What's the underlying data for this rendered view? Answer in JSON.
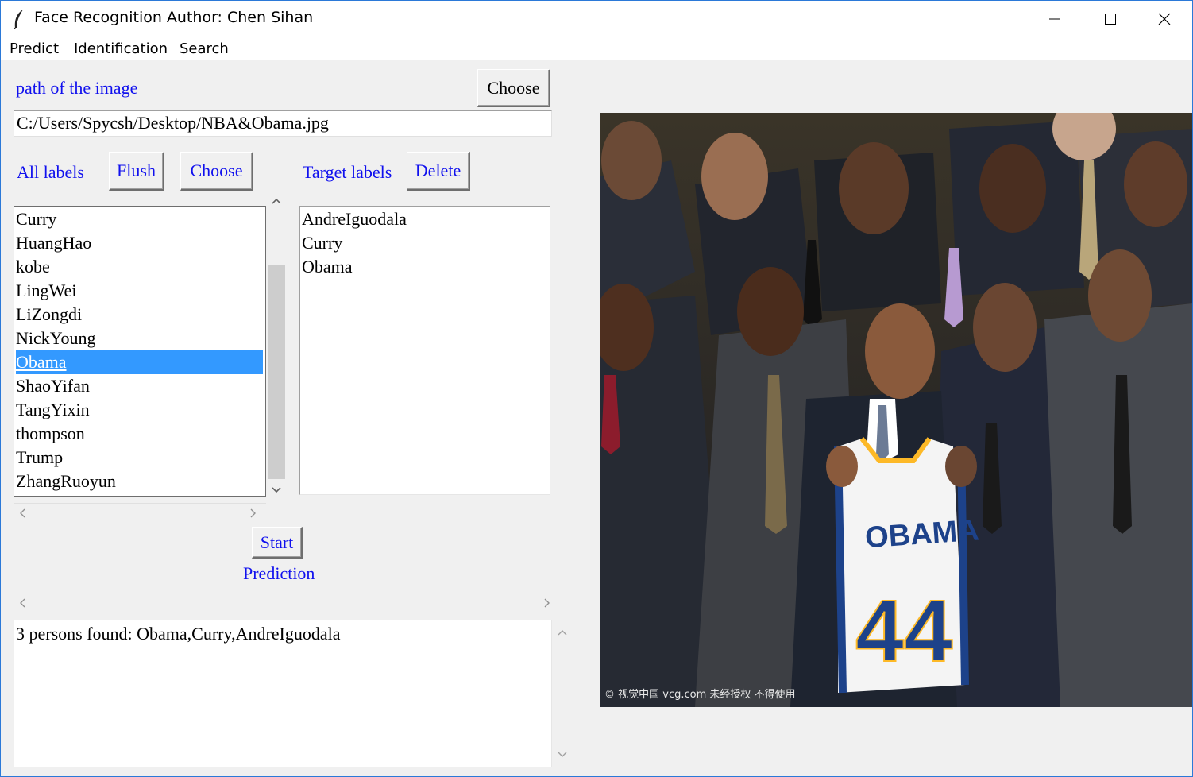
{
  "window": {
    "title": "Face Recognition Author: Chen Sihan",
    "controls": [
      "minimize-icon",
      "maximize-icon",
      "close-icon"
    ]
  },
  "menu": {
    "items": [
      "Predict",
      "Identification",
      "Search"
    ]
  },
  "image_path": {
    "label": "path of the image",
    "choose_button": "Choose",
    "value": "C:/Users/Spycsh/Desktop/NBA&Obama.jpg"
  },
  "labels": {
    "all_label": "All labels",
    "flush_button": "Flush",
    "choose_button": "Choose",
    "target_label": "Target labels",
    "delete_button": "Delete",
    "all_items": [
      "Curry",
      "HuangHao",
      "kobe",
      "LingWei",
      "LiZongdi",
      "NickYoung",
      "Obama",
      "ShaoYifan",
      "TangYixin",
      "thompson",
      "Trump",
      "ZhangRuoyun"
    ],
    "selected_item": "Obama",
    "target_items": [
      "AndreIguodala",
      "Curry",
      "Obama"
    ]
  },
  "prediction": {
    "start_button": "Start",
    "label": "Prediction",
    "result": "3 persons found: Obama,Curry,AndreIguodala"
  },
  "photo": {
    "jersey_name": "OBAMA",
    "jersey_number": "44",
    "watermark": "© 视觉中国 vcg.com  未经授权 不得使用"
  },
  "colors": {
    "label_blue": "#1010ee",
    "selection": "#3399ff",
    "window_bg": "#f0f0f0",
    "border_accent": "#2b79d8"
  }
}
